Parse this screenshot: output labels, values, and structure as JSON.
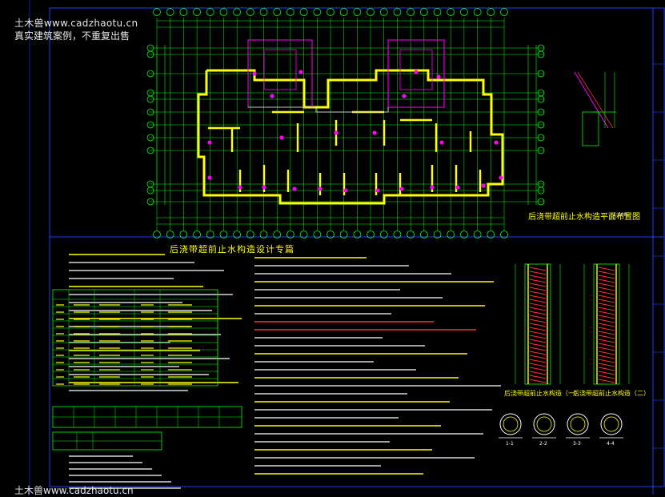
{
  "watermark": {
    "line1": "土木兽www.cadzhaotu.cn",
    "line2": "真实建筑案例，不重复出售",
    "line3": "土木兽www.cadzhaotu.cn"
  },
  "drawing": {
    "plan_title": "后浇带超前止水构造平面布置图",
    "plan_scale": "1:100",
    "notes_title": "后浇带超前止水构造设计专篇",
    "section_caption_1": "后浇带超前止水构造（一）",
    "section_caption_2": "后浇带超前止水构造（二）",
    "section_marks": [
      "1-1",
      "2-2",
      "3-3",
      "4-4"
    ]
  },
  "grid": {
    "top_axes": [
      "1",
      "2",
      "3",
      "4",
      "5",
      "6",
      "7",
      "8",
      "9",
      "10",
      "11",
      "12",
      "13",
      "14",
      "15",
      "16",
      "17",
      "18",
      "19",
      "20",
      "21",
      "22",
      "23",
      "24",
      "25",
      "26",
      "27"
    ],
    "left_axes": [
      "P",
      "N",
      "L",
      "K",
      "J",
      "H",
      "G",
      "F",
      "E",
      "D",
      "C",
      "B",
      "A"
    ]
  },
  "colors": {
    "background": "#000000",
    "frame": "#1f3fff",
    "grid": "#00ff00",
    "walls": "#ffff00",
    "columns": "#ff00ff",
    "text": "#ffffff",
    "dims": "#00ffff",
    "rebar": "#ff3030"
  }
}
